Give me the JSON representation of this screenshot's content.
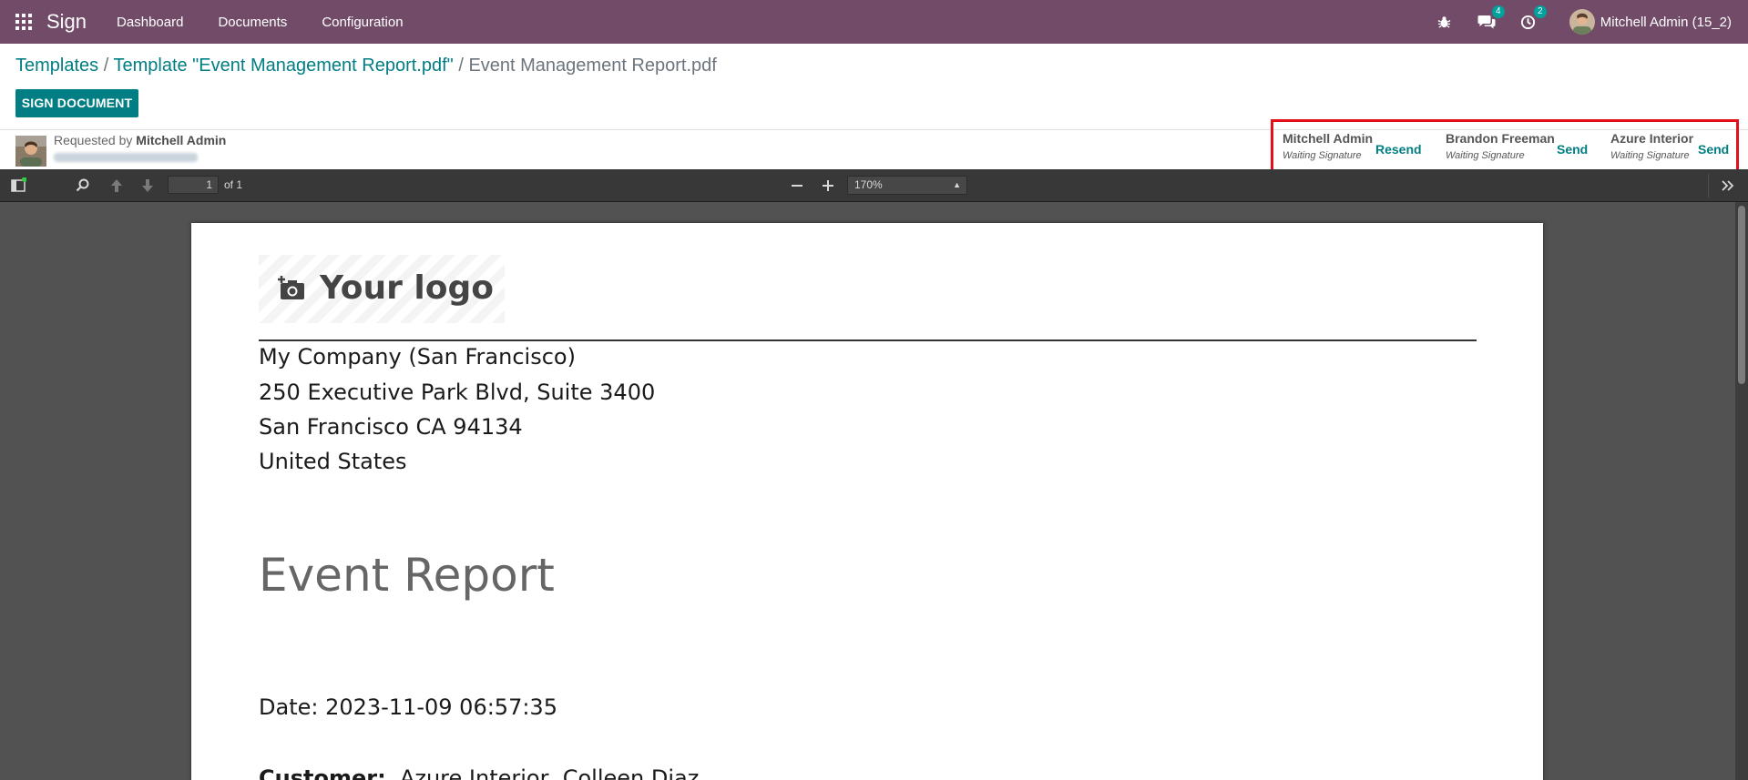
{
  "navbar": {
    "app_name": "Sign",
    "menu": [
      "Dashboard",
      "Documents",
      "Configuration"
    ],
    "messages_count": "4",
    "activities_count": "2",
    "user_name": "Mitchell Admin (15_2)",
    "bg_color": "#714b67"
  },
  "breadcrumb": {
    "templates": "Templates",
    "sep1": " / ",
    "template": "Template \"Event Management Report.pdf\"",
    "sep2": " / ",
    "current": "Event Management Report.pdf"
  },
  "actions": {
    "sign_document": "SIGN DOCUMENT"
  },
  "request": {
    "requested_by_label": "Requested by ",
    "requested_by_name": "Mitchell Admin"
  },
  "signers": [
    {
      "name": "Mitchell Admin",
      "state": "Waiting Signature",
      "action": "Resend"
    },
    {
      "name": "Brandon Freeman",
      "state": "Waiting Signature",
      "action": "Send"
    },
    {
      "name": "Azure Interior",
      "state": "Waiting Signature",
      "action": "Send"
    }
  ],
  "pdf_viewer": {
    "page_number": "1",
    "page_total": "of 1",
    "zoom": "170%",
    "icons": [
      "sidebar-toggle-icon",
      "search-icon",
      "previous-page-icon",
      "next-page-icon",
      "zoom-out-icon",
      "zoom-in-icon",
      "tools-icon"
    ]
  },
  "document": {
    "logo_text": "Your logo",
    "company": "My Company (San Francisco)",
    "street": "250 Executive Park Blvd, Suite 3400",
    "city": "San Francisco CA 94134",
    "country": "United States",
    "title": "Event Report",
    "date": "Date: 2023-11-09 06:57:35",
    "customer_label": "Customer:",
    "customer_value": "Azure Interior, Colleen Diaz"
  },
  "colors": {
    "accent": "#017e84",
    "highlight_box": "#e3101c"
  }
}
